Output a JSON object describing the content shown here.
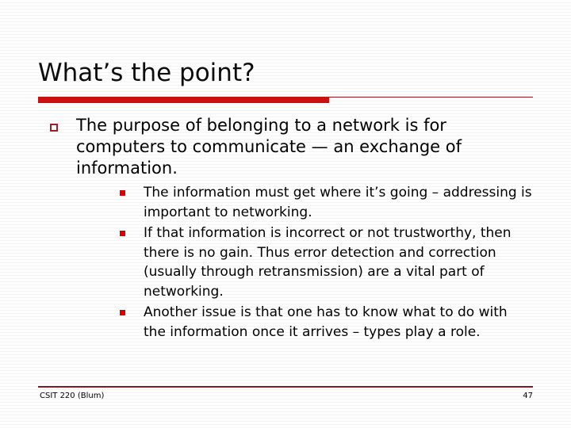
{
  "slide": {
    "title": "What’s the point?",
    "accent_color": "#cc1111",
    "rule_color": "#8c1a20",
    "bullet_lvl1_marker": "hollow-square-icon",
    "bullet_lvl2_marker": "filled-square-icon",
    "bullets": [
      {
        "text": "The purpose of belonging to a network is for computers to communicate — an exchange of information.",
        "children": [
          {
            "text": "The information must get where it’s going – addressing is important to networking."
          },
          {
            "text": "If that information is incorrect or not trustworthy, then there is no gain. Thus error detection and correction (usually through retransmission) are a vital part of networking."
          },
          {
            "text": "Another issue is that one has to know what to do with the information once it arrives – types play a role."
          }
        ]
      }
    ]
  },
  "footer": {
    "left_text": "CSIT 220 (Blum)",
    "slide_number": "47"
  }
}
